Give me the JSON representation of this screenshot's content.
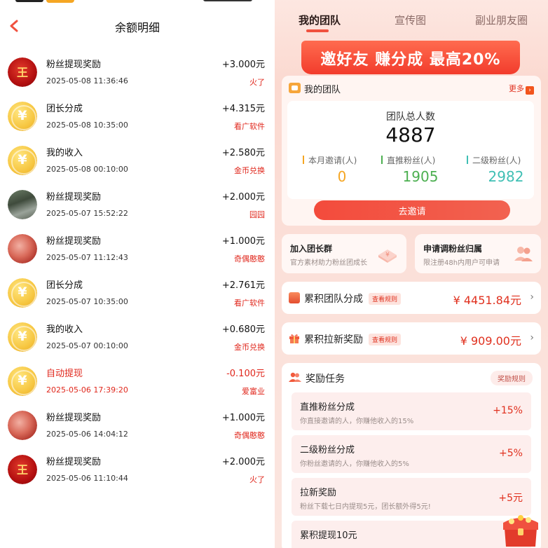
{
  "left": {
    "title": "余额明细",
    "records": [
      {
        "avatar": "red-emblem",
        "avatar_text": "王",
        "title": "粉丝提现奖励",
        "time": "2025-05-08 11:36:46",
        "amount": "+3.000元",
        "source": "火了",
        "negative": false
      },
      {
        "avatar": "yuan-coin",
        "avatar_text": "¥",
        "title": "团长分成",
        "time": "2025-05-08 10:35:00",
        "amount": "+4.315元",
        "source": "看广软件",
        "negative": false
      },
      {
        "avatar": "yuan-coin",
        "avatar_text": "¥",
        "title": "我的收入",
        "time": "2025-05-08 00:10:00",
        "amount": "+2.580元",
        "source": "金币兑换",
        "negative": false
      },
      {
        "avatar": "photo",
        "avatar_text": "",
        "title": "粉丝提现奖励",
        "time": "2025-05-07 15:52:22",
        "amount": "+2.000元",
        "source": "园园",
        "negative": false
      },
      {
        "avatar": "meat-photo",
        "avatar_text": "",
        "title": "粉丝提现奖励",
        "time": "2025-05-07 11:12:43",
        "amount": "+1.000元",
        "source": "奇偶憨憨",
        "negative": false
      },
      {
        "avatar": "yuan-coin",
        "avatar_text": "¥",
        "title": "团长分成",
        "time": "2025-05-07 10:35:00",
        "amount": "+2.761元",
        "source": "看广软件",
        "negative": false
      },
      {
        "avatar": "yuan-coin",
        "avatar_text": "¥",
        "title": "我的收入",
        "time": "2025-05-07 00:10:00",
        "amount": "+0.680元",
        "source": "金币兑换",
        "negative": false
      },
      {
        "avatar": "yuan-coin",
        "avatar_text": "¥",
        "title": "自动提现",
        "time": "2025-05-06 17:39:20",
        "amount": "-0.100元",
        "source": "爱富业",
        "negative": true
      },
      {
        "avatar": "meat-photo",
        "avatar_text": "",
        "title": "粉丝提现奖励",
        "time": "2025-05-06 14:04:12",
        "amount": "+1.000元",
        "source": "奇偶憨憨",
        "negative": false
      },
      {
        "avatar": "red-emblem",
        "avatar_text": "王",
        "title": "粉丝提现奖励",
        "time": "2025-05-06 11:10:44",
        "amount": "+2.000元",
        "source": "火了",
        "negative": false
      }
    ]
  },
  "right": {
    "tabs": [
      "我的团队",
      "宣传图",
      "副业朋友圈"
    ],
    "active_tab": 0,
    "promo_banner": "邀好友 赚分成 最高20%",
    "team": {
      "title": "我的团队",
      "more": "更多",
      "total_label": "团队总人数",
      "total_value": "4887",
      "stats": [
        {
          "label": "本月邀请(人)",
          "value": "0",
          "color": "#f5a623"
        },
        {
          "label": "直推粉丝(人)",
          "value": "1905",
          "color": "#4caf50"
        },
        {
          "label": "二级粉丝(人)",
          "value": "2982",
          "color": "#3fbfb4"
        }
      ],
      "invite_button": "去邀请"
    },
    "shortcuts": [
      {
        "title": "加入团长群",
        "subtitle": "官方素材助力粉丝团成长"
      },
      {
        "title": "申请调粉丝归属",
        "subtitle": "限注册48h内用户可申请"
      }
    ],
    "summaries": [
      {
        "title": "累积团队分成",
        "rule": "查看规则",
        "value": "¥ 4451.84元"
      },
      {
        "title": "累积拉新奖励",
        "rule": "查看规则",
        "value": "¥ 909.00元"
      }
    ],
    "tasks": {
      "title": "奖励任务",
      "rule_button": "奖励规则",
      "items": [
        {
          "title": "直推粉丝分成",
          "subtitle": "你直接邀请的人，你赚他收入的15%",
          "value": "+15%"
        },
        {
          "title": "二级粉丝分成",
          "subtitle": "你粉丝邀请的人，你赚他收入的5%",
          "value": "+5%"
        },
        {
          "title": "拉新奖励",
          "subtitle": "粉丝下载七日内提现5元，团长额外得5元!",
          "value": "+5元"
        },
        {
          "title": "累积提现10元",
          "subtitle": "",
          "value": ""
        }
      ]
    },
    "colors": {
      "accent": "#f0513f",
      "amount_red": "#e0301e"
    }
  }
}
